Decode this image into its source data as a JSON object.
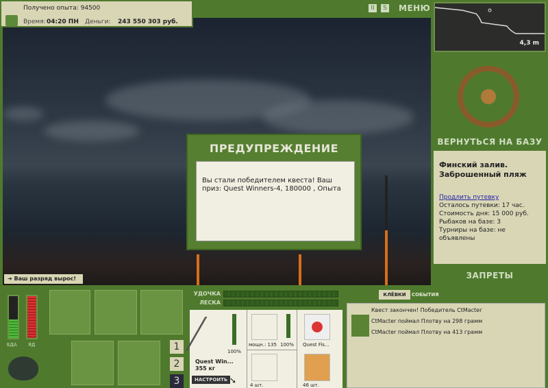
{
  "info": {
    "xp_label": "Получено опыта: 94500",
    "time_label": "Время:",
    "time": "04:20 ПН",
    "money_label": "Деньги:",
    "money": "243 550 303 руб."
  },
  "topbar": {
    "pause_icon": "pause-icon",
    "sound_icon": "sound-icon",
    "menu": "МЕНЮ"
  },
  "depth": {
    "value": "4,3 m"
  },
  "right": {
    "return": "ВЕРНУТЬСЯ НА БАЗУ",
    "location": "Финский залив. Заброшенный пляж",
    "extend": "Продлить путевку",
    "remain": "Осталось путевки: 17 час.",
    "cost": "Стоимость дня: 15 000 руб.",
    "fishers": "Рыбаков на базе: 3",
    "tournaments": "Турниры на базе: не объявлены",
    "bans": "ЗАПРЕТЫ"
  },
  "dialog": {
    "title": "ПРЕДУПРЕЖДЕНИЕ",
    "message": "Вы стали победителем квеста! Ваш приз: Quest Winners-4, 180000 , Опыта"
  },
  "notice": "Ваш разряд вырос!",
  "stats": {
    "food": "ЕДА",
    "poison": "ЯД",
    "food_level": 0.45,
    "poison_level": 1.0
  },
  "pages": [
    "1",
    "2",
    "3"
  ],
  "active_page": "3",
  "gear": {
    "rod_label": "УДОЧКА",
    "line_label": "ЛЕСКА",
    "rod_name": "Quest Win...",
    "rod_weight": "355 кг",
    "rod_condition": "100%",
    "setup": "НАСТРОИТЬ",
    "reel_info": "мощн.: 135",
    "reel_condition": "100%",
    "line_name": "Quest Fis...",
    "hook_count": "4 шт.",
    "bait_count": "46 шт."
  },
  "events": {
    "tab_bites": "КЛЁВКИ",
    "tab_events": "СОБЫТИЯ",
    "items": [
      "Квест закончен! Победитель CtMacter",
      "CtMacter поймал Плотву на 298 грамм",
      "CtMacter поймал Плотву на 413 грамм"
    ]
  }
}
